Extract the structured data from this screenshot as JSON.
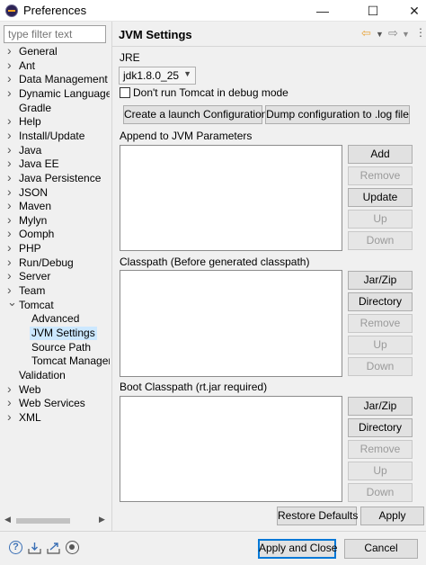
{
  "window": {
    "title": "Preferences",
    "minimize": "—",
    "maximize": "☐",
    "close": "✕"
  },
  "filter": {
    "placeholder": "type filter text"
  },
  "tree": {
    "items": [
      {
        "label": "General",
        "level": 0,
        "expandable": true
      },
      {
        "label": "Ant",
        "level": 0,
        "expandable": true
      },
      {
        "label": "Data Management",
        "level": 0,
        "expandable": true
      },
      {
        "label": "Dynamic Languages",
        "level": 0,
        "expandable": true
      },
      {
        "label": "Gradle",
        "level": 0,
        "expandable": false
      },
      {
        "label": "Help",
        "level": 0,
        "expandable": true
      },
      {
        "label": "Install/Update",
        "level": 0,
        "expandable": true
      },
      {
        "label": "Java",
        "level": 0,
        "expandable": true
      },
      {
        "label": "Java EE",
        "level": 0,
        "expandable": true
      },
      {
        "label": "Java Persistence",
        "level": 0,
        "expandable": true
      },
      {
        "label": "JSON",
        "level": 0,
        "expandable": true
      },
      {
        "label": "Maven",
        "level": 0,
        "expandable": true
      },
      {
        "label": "Mylyn",
        "level": 0,
        "expandable": true
      },
      {
        "label": "Oomph",
        "level": 0,
        "expandable": true
      },
      {
        "label": "PHP",
        "level": 0,
        "expandable": true
      },
      {
        "label": "Run/Debug",
        "level": 0,
        "expandable": true
      },
      {
        "label": "Server",
        "level": 0,
        "expandable": true
      },
      {
        "label": "Team",
        "level": 0,
        "expandable": true
      },
      {
        "label": "Tomcat",
        "level": 0,
        "expandable": true,
        "expanded": true
      },
      {
        "label": "Advanced",
        "level": 1,
        "expandable": false
      },
      {
        "label": "JVM Settings",
        "level": 1,
        "expandable": false,
        "selected": true
      },
      {
        "label": "Source Path",
        "level": 1,
        "expandable": false
      },
      {
        "label": "Tomcat Manager",
        "level": 1,
        "expandable": false
      },
      {
        "label": "Validation",
        "level": 0,
        "expandable": false
      },
      {
        "label": "Web",
        "level": 0,
        "expandable": true
      },
      {
        "label": "Web Services",
        "level": 0,
        "expandable": true
      },
      {
        "label": "XML",
        "level": 0,
        "expandable": true
      }
    ]
  },
  "page": {
    "title": "JVM Settings",
    "jre_label": "JRE",
    "jre_value": "jdk1.8.0_25",
    "debug_checkbox_label": "Don't run Tomcat in debug mode",
    "debug_checked": false,
    "create_launch_button": "Create a launch Configuration",
    "dump_config_button": "Dump configuration to .log file",
    "append_label": "Append to JVM Parameters",
    "append_buttons": {
      "add": "Add",
      "remove": "Remove",
      "update": "Update",
      "up": "Up",
      "down": "Down"
    },
    "classpath_label": "Classpath (Before generated classpath)",
    "classpath_buttons": {
      "jarzip": "Jar/Zip",
      "directory": "Directory",
      "remove": "Remove",
      "up": "Up",
      "down": "Down"
    },
    "boot_label": "Boot Classpath (rt.jar required)",
    "boot_buttons": {
      "jarzip": "Jar/Zip",
      "directory": "Directory",
      "remove": "Remove",
      "up": "Up",
      "down": "Down"
    },
    "restore_defaults": "Restore Defaults",
    "apply": "Apply"
  },
  "nav": {
    "back": "⇦",
    "back_menu": "▼",
    "forward": "⇨",
    "forward_menu": "▼",
    "more": "⋮"
  },
  "footer": {
    "apply_close": "Apply and Close",
    "cancel": "Cancel",
    "help_glyph": "?"
  },
  "scroll": {
    "left": "◀",
    "right": "▶"
  },
  "icons": [
    "help-icon",
    "import-icon",
    "export-icon",
    "record-icon"
  ],
  "colors": {
    "selection": "#cce8ff",
    "primary_border": "#0078d7"
  }
}
